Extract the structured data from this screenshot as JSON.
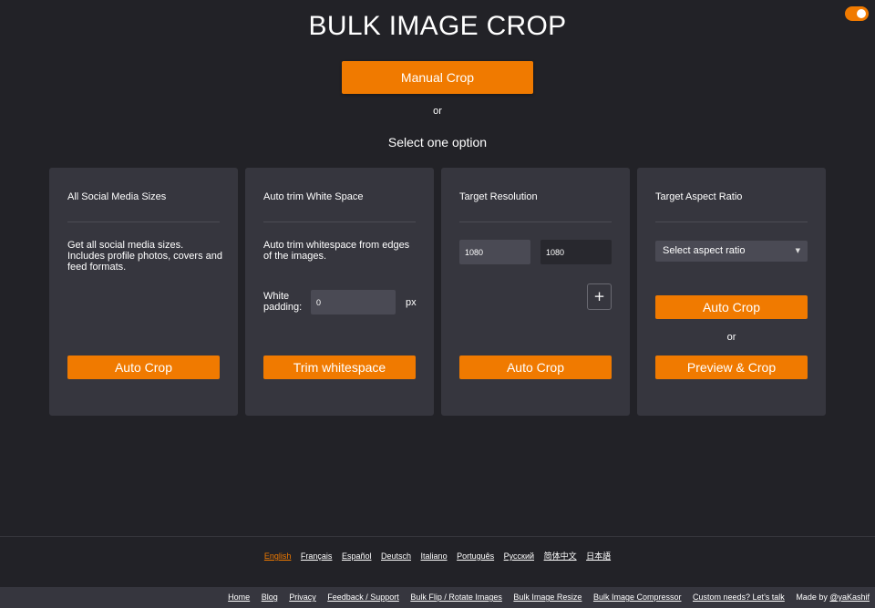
{
  "header": {
    "title": "BULK IMAGE CROP",
    "manual_crop_label": "Manual Crop",
    "or_text": "or",
    "select_option_text": "Select one option"
  },
  "toggle": {
    "state": "on",
    "color": "#f07a00"
  },
  "cards": {
    "social": {
      "title": "All Social Media Sizes",
      "description": "Get all social media sizes. Includes profile photos, covers and feed formats.",
      "button_label": "Auto Crop"
    },
    "trim": {
      "title": "Auto trim White Space",
      "description": "Auto trim whitespace from edges of the images.",
      "padding_label": "White padding:",
      "padding_value": "0",
      "unit": "px",
      "button_label": "Trim whitespace"
    },
    "resolution": {
      "title": "Target Resolution",
      "width_value": "1080",
      "height_value": "1080",
      "add_label": "+",
      "button_label": "Auto Crop"
    },
    "aspect": {
      "title": "Target Aspect Ratio",
      "select_value": "Select aspect ratio",
      "caret": "▼",
      "auto_label": "Auto Crop",
      "or_text": "or",
      "preview_label": "Preview & Crop"
    }
  },
  "languages": [
    {
      "label": "English",
      "active": true
    },
    {
      "label": "Français",
      "active": false
    },
    {
      "label": "Español",
      "active": false
    },
    {
      "label": "Deutsch",
      "active": false
    },
    {
      "label": "Italiano",
      "active": false
    },
    {
      "label": "Português",
      "active": false
    },
    {
      "label": "Русский",
      "active": false
    },
    {
      "label": "简体中文",
      "active": false
    },
    {
      "label": "日本語",
      "active": false
    }
  ],
  "footer": {
    "links": [
      "Home",
      "Blog",
      "Privacy",
      "Feedback / Support",
      "Bulk Flip / Rotate Images",
      "Bulk Image Resize",
      "Bulk Image Compressor",
      "Custom needs? Let's talk"
    ],
    "made_by_text": "Made by ",
    "author": "@yaKashif"
  },
  "colors": {
    "accent": "#f07a00",
    "background": "#222227",
    "card": "#36363e",
    "input": "#4a4a54"
  }
}
